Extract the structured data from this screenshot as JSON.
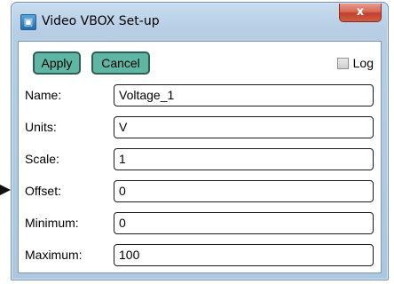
{
  "window": {
    "title": "Video VBOX Set-up",
    "close_glyph": "x",
    "app_icon": "video-vbox-icon"
  },
  "toolbar": {
    "apply_label": "Apply",
    "cancel_label": "Cancel",
    "log_label": "Log",
    "log_checked": false
  },
  "fields": [
    {
      "label": "Name:",
      "value": "Voltage_1"
    },
    {
      "label": "Units:",
      "value": "V"
    },
    {
      "label": "Scale:",
      "value": "1"
    },
    {
      "label": "Offset:",
      "value": "0"
    },
    {
      "label": "Minimum:",
      "value": "0"
    },
    {
      "label": "Maximum:",
      "value": "100"
    }
  ],
  "pointer": "arrow-pointer-icon",
  "colors": {
    "button_fill": "#5fb6a2",
    "title_bar": "#b7cde4",
    "close_button": "#c1402c"
  }
}
